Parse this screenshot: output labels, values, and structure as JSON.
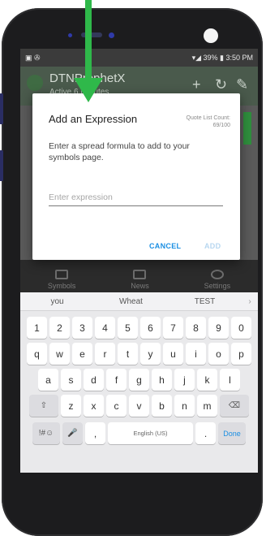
{
  "status_bar": {
    "left_icons": "▣ ✇",
    "right_text": "▾◢ 39% ▮ 3:50 PM"
  },
  "app_bar": {
    "title": "DTNProphetX",
    "subtitle": "Active 6 Minutes"
  },
  "dialog": {
    "title": "Add an Expression",
    "count_label": "Quote List Count: 69/100",
    "message": "Enter a spread formula to add to your symbols page.",
    "input_placeholder": "Enter expression",
    "input_value": "",
    "cancel_label": "CANCEL",
    "add_label": "ADD"
  },
  "bottom_nav": [
    {
      "label": "Symbols"
    },
    {
      "label": "News"
    },
    {
      "label": "Settings"
    }
  ],
  "keyboard": {
    "suggestions": [
      "you",
      "Wheat",
      "TEST"
    ],
    "row_numbers": [
      "1",
      "2",
      "3",
      "4",
      "5",
      "6",
      "7",
      "8",
      "9",
      "0"
    ],
    "row_top": [
      "q",
      "w",
      "e",
      "r",
      "t",
      "y",
      "u",
      "i",
      "o",
      "p"
    ],
    "row_mid": [
      "a",
      "s",
      "d",
      "f",
      "g",
      "h",
      "j",
      "k",
      "l"
    ],
    "row_bottom": [
      "z",
      "x",
      "c",
      "v",
      "b",
      "n",
      "m"
    ],
    "shift_label": "⇧",
    "backspace_label": "⌫",
    "sym_label": "!#☺",
    "mic_label": "🎤",
    "comma_label": ",",
    "space_label": "English (US)",
    "period_label": ".",
    "done_label": "Done"
  },
  "colors": {
    "arrow": "#2fb84a",
    "accent_blue": "#1b8fe3",
    "phone_body": "#1c1c1e"
  }
}
